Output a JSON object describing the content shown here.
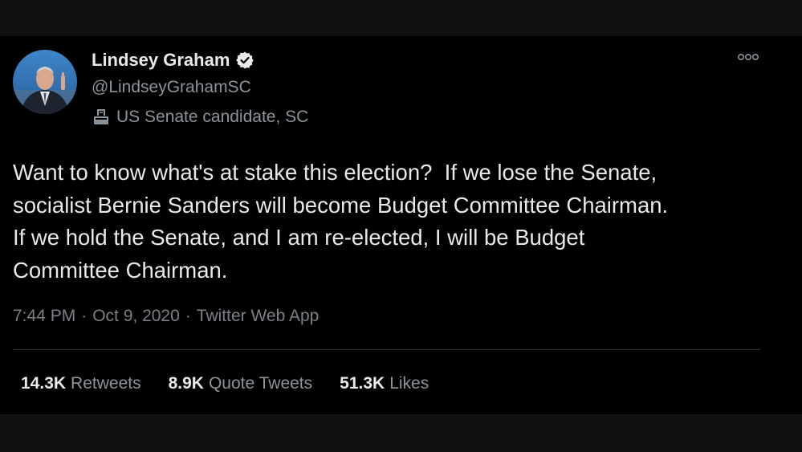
{
  "profile": {
    "display_name": "Lindsey Graham",
    "handle": "@LindseyGrahamSC",
    "label": "US Senate candidate, SC",
    "verified": true
  },
  "tweet": {
    "text": "Want to know what's at stake this election?  If we lose the Senate,\nsocialist Bernie Sanders will become Budget Committee Chairman.\nIf we hold the Senate, and I am re-elected, I will be Budget\nCommittee Chairman.",
    "time": "7:44 PM",
    "separator": "·",
    "date": "Oct 9, 2020",
    "source": "Twitter Web App"
  },
  "stats": [
    {
      "count": "14.3K",
      "label": "Retweets"
    },
    {
      "count": "8.9K",
      "label": "Quote Tweets"
    },
    {
      "count": "51.3K",
      "label": "Likes"
    }
  ],
  "icons": {
    "verified": "verified-badge-icon",
    "label": "ballot-box-icon",
    "more": "more-options-icon"
  },
  "colors": {
    "background": "#000000",
    "text_primary": "#e7e9ea",
    "text_secondary": "#8b949a"
  }
}
